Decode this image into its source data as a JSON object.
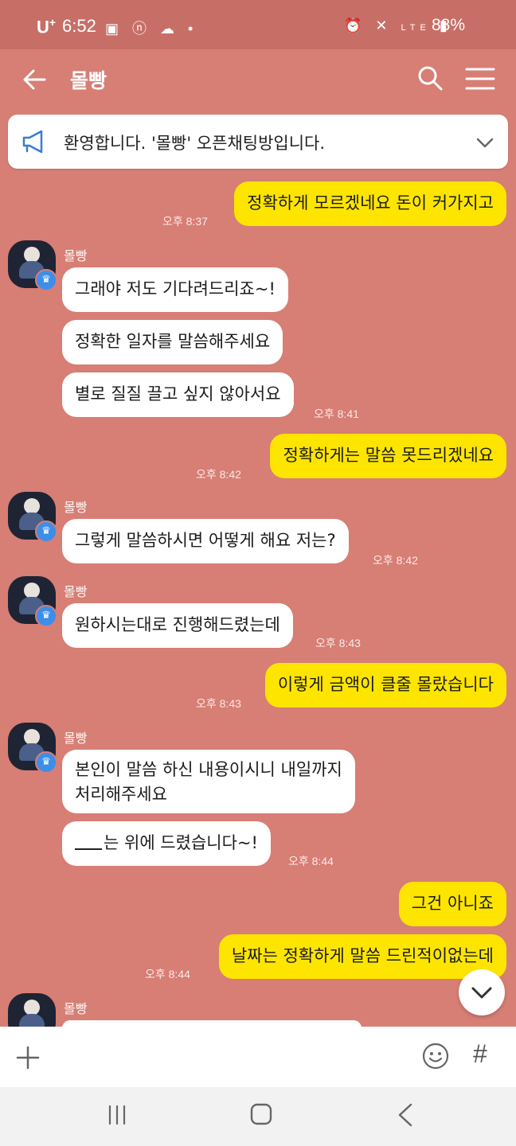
{
  "status_bar": {
    "carrier": "U",
    "carrier_sup": "+",
    "time": "6:52",
    "battery": "88%",
    "network": "LTE"
  },
  "header": {
    "title": "몰빵"
  },
  "notice": {
    "text": "환영합니다. '몰빵' 오픈채팅방입니다."
  },
  "messages": [
    {
      "from": "me",
      "text": "정확하게 모르겠네요 돈이 커가지고",
      "time": "오후 8:37"
    },
    {
      "from": "other",
      "sender": "몰빵",
      "text": "그래야 저도 기다려드리죠~!"
    },
    {
      "from": "other",
      "text": "정확한 일자를 말씀해주세요"
    },
    {
      "from": "other",
      "text": "별로 질질 끌고 싶지 않아서요",
      "time": "오후 8:41"
    },
    {
      "from": "me",
      "text": "정확하게는 말씀 못드리겠네요",
      "time": "오후 8:42"
    },
    {
      "from": "other",
      "sender": "몰빵",
      "text": "그렇게 말씀하시면 어떻게 해요 저는?",
      "time": "오후 8:42"
    },
    {
      "from": "other",
      "sender": "몰빵",
      "text": "원하시는대로 진행해드렸는데",
      "time": "오후 8:43"
    },
    {
      "from": "me",
      "text": "이렇게 금액이 클줄 몰랐습니다",
      "time": "오후 8:43"
    },
    {
      "from": "other",
      "sender": "몰빵",
      "line1": "본인이 말씀 하신 내용이시니 내일까지",
      "line2": "처리해주세요"
    },
    {
      "from": "other",
      "text": "는 위에 드렸습니다~!",
      "time": "오후 8:44"
    },
    {
      "from": "me",
      "text": "그건 아니죠"
    },
    {
      "from": "me",
      "text": "날짜는 정확하게 말씀 드린적이없는데",
      "time": "오후 8:44"
    },
    {
      "from": "other",
      "sender": "몰빵"
    }
  ],
  "colors": {
    "background": "#d77e75",
    "my_bubble": "#fee500",
    "other_bubble": "#ffffff",
    "crown_badge": "#3d8ee8"
  },
  "icons": [
    "back-arrow-icon",
    "search-icon",
    "menu-icon",
    "megaphone-icon",
    "chevron-down-icon",
    "plus-icon",
    "emoji-icon",
    "hash-icon",
    "crown-icon"
  ]
}
